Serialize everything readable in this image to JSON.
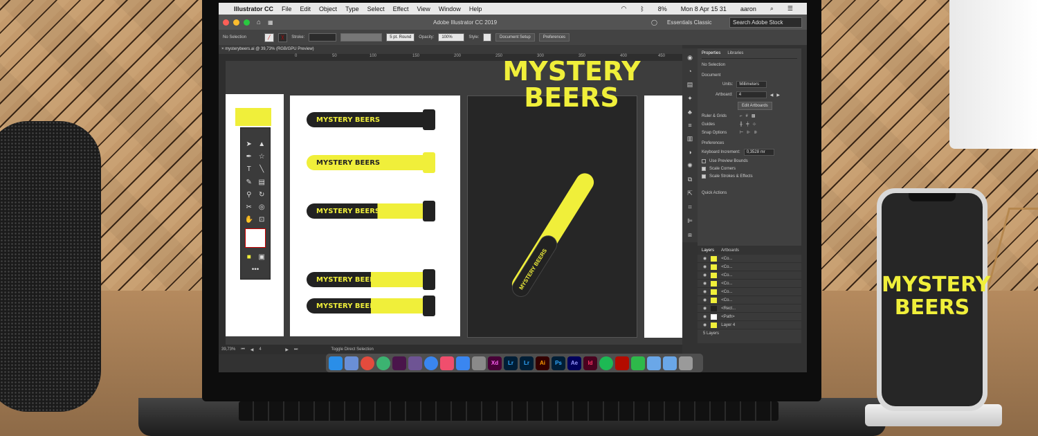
{
  "menubar": {
    "app_name": "Illustrator CC",
    "items": [
      "File",
      "Edit",
      "Object",
      "Type",
      "Select",
      "Effect",
      "View",
      "Window",
      "Help"
    ],
    "battery": "8%",
    "datetime": "Mon 8 Apr  15 31",
    "user": "aaron"
  },
  "titlebar": {
    "title": "Adobe Illustrator CC 2019",
    "workspace": "Essentials Classic",
    "search_placeholder": "Search Adobe Stock"
  },
  "controlbar": {
    "selection": "No Selection",
    "stroke_label": "Stroke:",
    "brush": "5 pt. Round",
    "opacity_label": "Opacity:",
    "opacity_value": "100%",
    "style_label": "Style:",
    "document_setup": "Document Setup",
    "preferences": "Preferences"
  },
  "document_tab": "mysterybeers.ai @ 39,73% (RGB/GPU Preview)",
  "ruler_ticks": [
    "0",
    "50",
    "100",
    "150",
    "200",
    "250",
    "300",
    "350",
    "400",
    "450"
  ],
  "artwork": {
    "brand": "MYSTERY BEERS",
    "brand_line1": "MYSTERY",
    "brand_line2": "BEERS"
  },
  "properties_panel": {
    "tab_properties": "Properties",
    "tab_libraries": "Libraries",
    "selection": "No Selection",
    "document": "Document",
    "units_label": "Units:",
    "units_value": "Millimeters",
    "artboard_label": "Artboard:",
    "artboard_value": "4",
    "edit_artboards": "Edit Artboards",
    "ruler_grids": "Ruler & Grids",
    "guides": "Guides",
    "snap_options": "Snap Options",
    "preferences": "Preferences",
    "keyboard_increment_label": "Keyboard Increment:",
    "keyboard_increment_value": "0,3528 mr",
    "use_preview_bounds": "Use Preview Bounds",
    "scale_corners": "Scale Corners",
    "scale_strokes": "Scale Strokes & Effects",
    "quick_actions": "Quick Actions"
  },
  "layers_panel": {
    "tab_layers": "Layers",
    "tab_artboards": "Artboards",
    "rows": [
      "<Co...",
      "<Co...",
      "<Co...",
      "<Co...",
      "<Co...",
      "<Co...",
      "<Rect...",
      "<Path>",
      "Layer 4"
    ],
    "footer": "5 Layers"
  },
  "statusbar": {
    "zoom": "39,73%",
    "artboard": "4",
    "tool": "Toggle Direct Selection"
  },
  "dock_apps": [
    "Xd",
    "Lr",
    "Lr",
    "Ai",
    "Ps",
    "Ae",
    "Id"
  ],
  "colors": {
    "brand_yellow": "#f0ef3a",
    "brand_dark": "#222222"
  }
}
